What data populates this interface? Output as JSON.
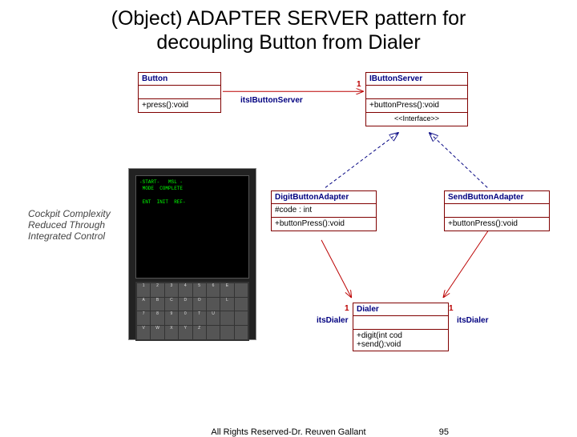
{
  "title_line1": "(Object) ADAPTER SERVER pattern for",
  "title_line2": "decoupling Button from Dialer",
  "cockpit_text": "Cockpit Complexity Reduced Through Integrated Control",
  "classes": {
    "button": {
      "name": "Button",
      "op": "+press():void"
    },
    "ibs": {
      "name": "IButtonServer",
      "op": "+buttonPress():void",
      "stereo": "<<Interface>>"
    },
    "dba": {
      "name": "DigitButtonAdapter",
      "attr": "#code : int",
      "op": "+buttonPress():void"
    },
    "sba": {
      "name": "SendButtonAdapter",
      "op": "+buttonPress():void"
    },
    "dialer": {
      "name": "Dialer",
      "op1": "+digit(int cod",
      "op2": "+send():void"
    }
  },
  "labels": {
    "itsIButtonServer": "itsIButtonServer",
    "itsDialer1": "itsDialer",
    "itsDialer2": "itsDialer",
    "one_a": "1",
    "one_b": "1",
    "one_c": "1"
  },
  "footer": {
    "copyright": "All Rights Reserved-Dr. Reuven Gallant",
    "page": "95"
  }
}
